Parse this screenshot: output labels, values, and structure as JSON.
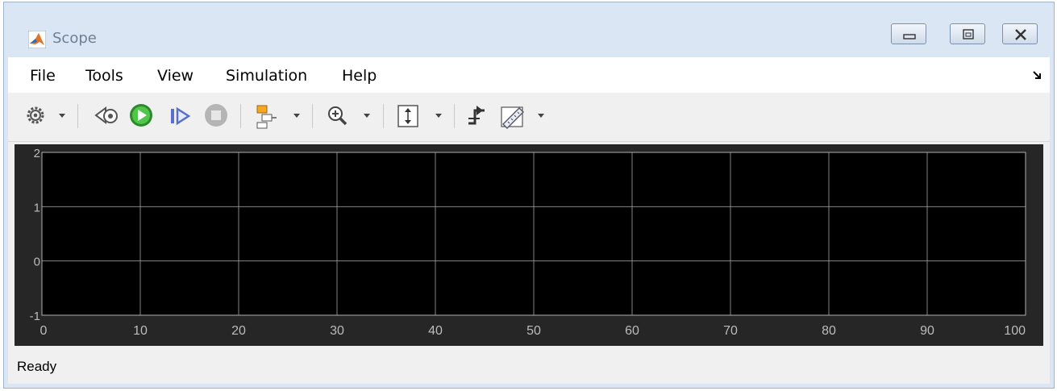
{
  "window": {
    "title": "Scope",
    "controls": [
      "minimize",
      "restore",
      "close"
    ]
  },
  "menubar": {
    "items": [
      "File",
      "Tools",
      "View",
      "Simulation",
      "Help"
    ]
  },
  "toolbar": {
    "icons": [
      "settings-icon",
      "step-back-icon",
      "run-icon",
      "step-forward-icon",
      "stop-icon",
      "layout-icon",
      "zoom-in-icon",
      "scale-axes-icon",
      "triggers-icon",
      "measurements-icon"
    ]
  },
  "chart_data": {
    "type": "line",
    "x": [],
    "series": [],
    "xlim": [
      0,
      100
    ],
    "ylim": [
      -1,
      2
    ],
    "xticks": [
      0,
      10,
      20,
      30,
      40,
      50,
      60,
      70,
      80,
      90,
      100
    ],
    "yticks": [
      -1,
      0,
      1,
      2
    ],
    "grid": true,
    "background": "#000000",
    "frame_color": "#262626",
    "grid_color": "#b0b0b0",
    "tick_label_color": "#bbbbbb"
  },
  "status": {
    "text": "Ready"
  }
}
